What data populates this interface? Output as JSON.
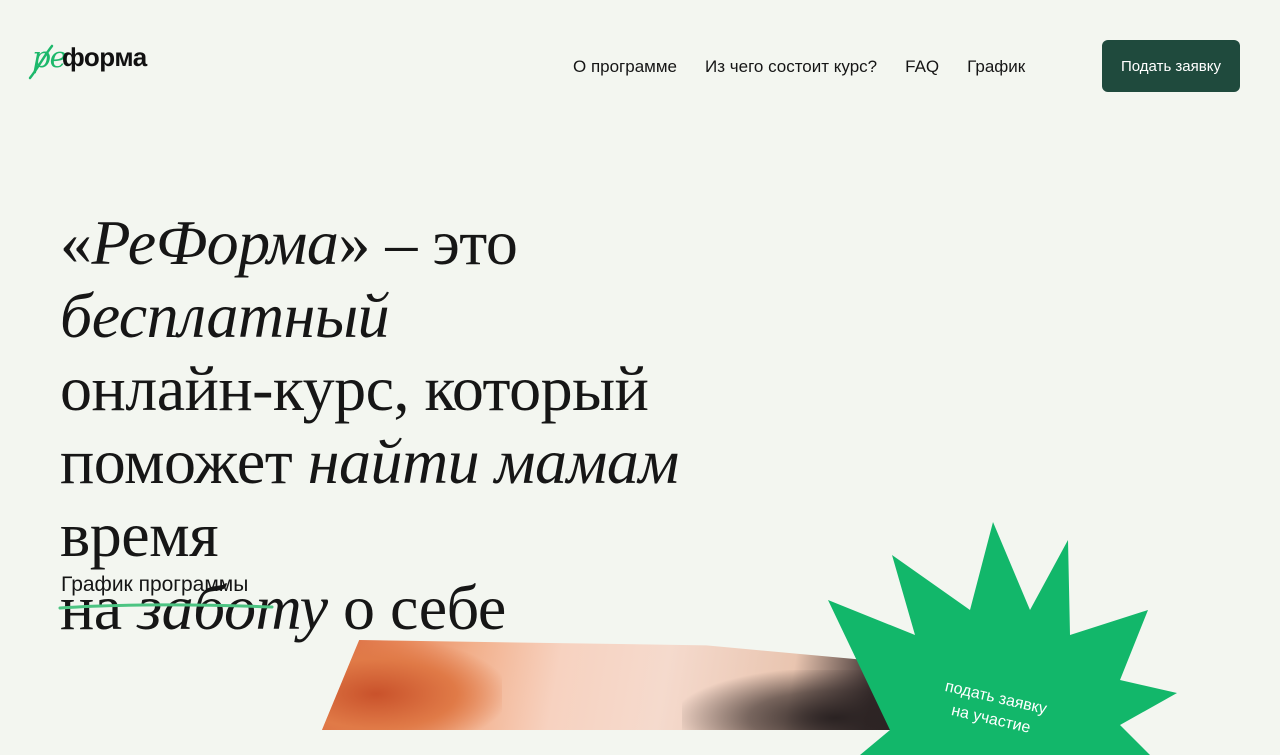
{
  "brand": {
    "logo_re": "ре",
    "logo_forma": "форма"
  },
  "nav": {
    "items": [
      {
        "label": "О программе"
      },
      {
        "label": "Из чего состоит курс?"
      },
      {
        "label": "FAQ"
      },
      {
        "label": "График"
      }
    ]
  },
  "header": {
    "cta_label": "Подать заявку"
  },
  "hero": {
    "t1": "«",
    "t2": "РеФорма",
    "t3": "» – это ",
    "t4": "бесплатный",
    "t5": "онлайн-курс, который",
    "t6": "поможет ",
    "t7": "найти мамам",
    "t8": " время",
    "t9": "на ",
    "t10": "заботу",
    "t11": " о себе",
    "schedule_link": "График программы"
  },
  "badge": {
    "line1": "подать заявку",
    "line2": "на участие"
  },
  "colors": {
    "accent_green": "#12b76a",
    "cta_bg": "#1f4a3d",
    "background": "#f3f6f0"
  }
}
